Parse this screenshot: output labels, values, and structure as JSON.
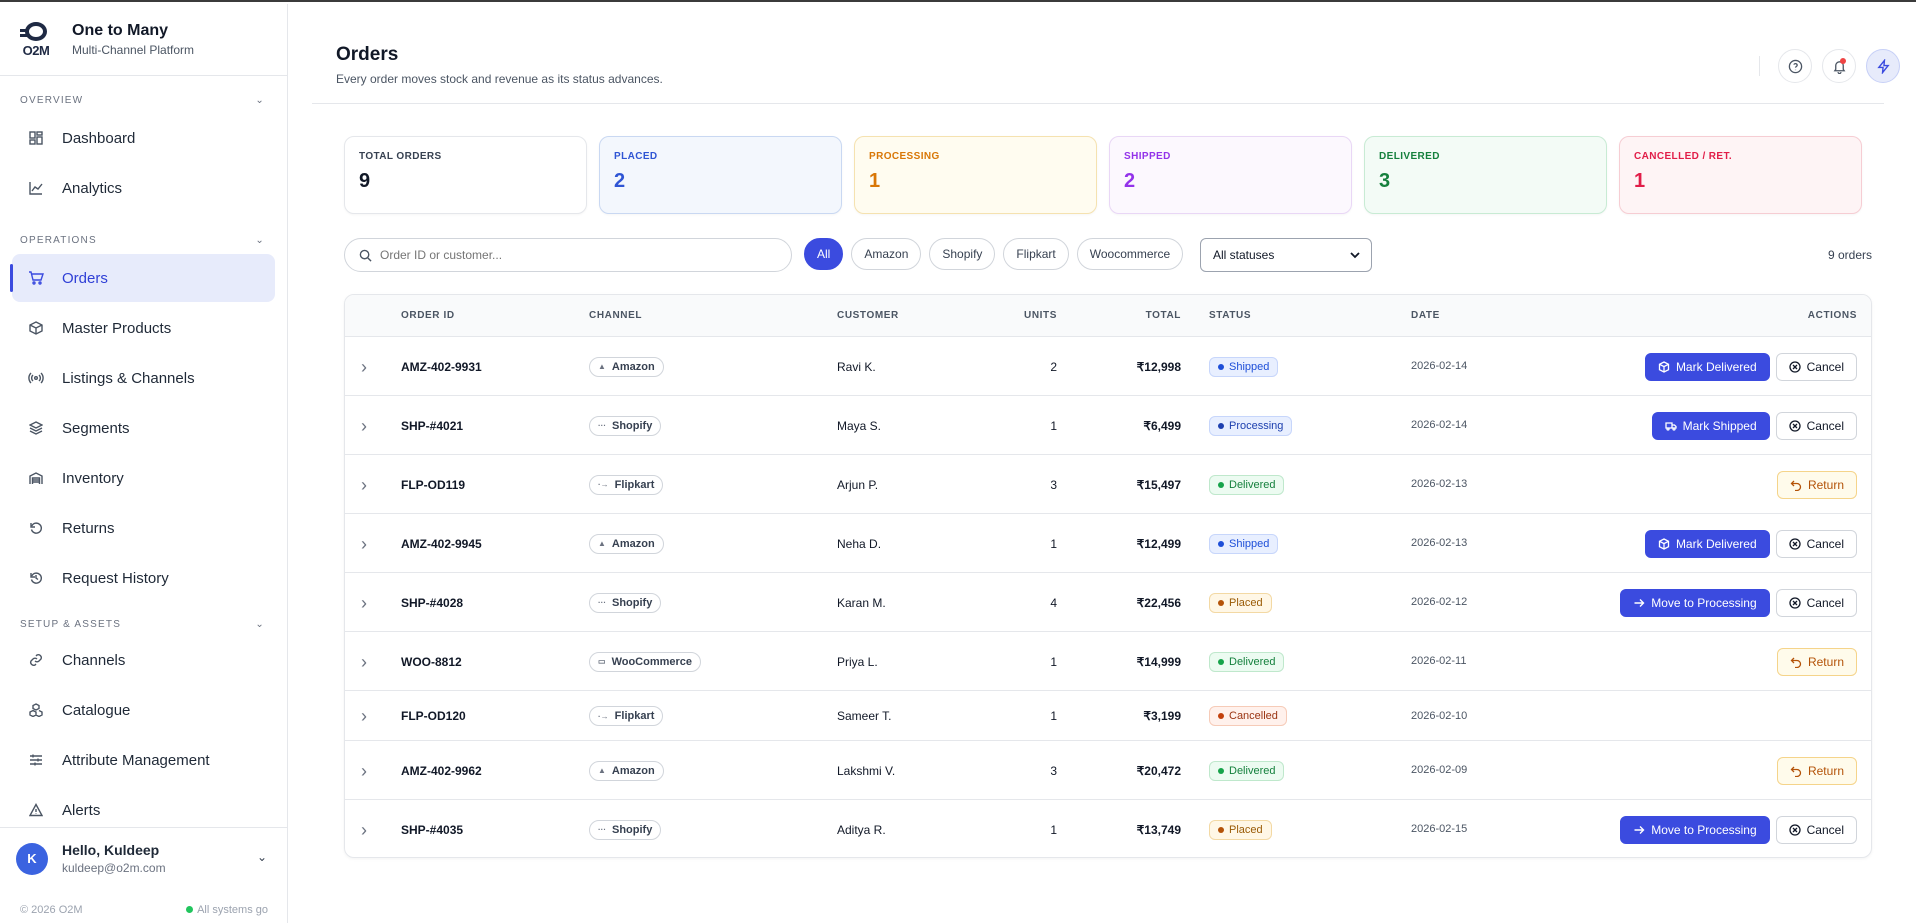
{
  "brand": {
    "logo": "O2M",
    "title": "One to Many",
    "subtitle": "Multi-Channel Platform"
  },
  "sections": {
    "overview": "OVERVIEW",
    "operations": "OPERATIONS",
    "setup": "SETUP & ASSETS"
  },
  "nav": {
    "dashboard": "Dashboard",
    "analytics": "Analytics",
    "orders": "Orders",
    "master_products": "Master Products",
    "listings": "Listings & Channels",
    "segments": "Segments",
    "inventory": "Inventory",
    "returns": "Returns",
    "request_history": "Request History",
    "channels": "Channels",
    "catalogue": "Catalogue",
    "attribute_management": "Attribute Management",
    "alerts": "Alerts"
  },
  "user": {
    "initial": "K",
    "greeting": "Hello, Kuldeep",
    "email": "kuldeep@o2m.com"
  },
  "footer": {
    "copyright": "© 2026 O2M",
    "status": "All systems go"
  },
  "page": {
    "title": "Orders",
    "subtitle": "Every order moves stock and revenue as its status advances."
  },
  "stats": [
    {
      "label": "TOTAL ORDERS",
      "value": "9",
      "color": "#111827",
      "bg": "#ffffff",
      "border": "#e5e7eb"
    },
    {
      "label": "PLACED",
      "value": "2",
      "color": "#2f55d4",
      "bg": "#f3f7fd",
      "border": "#c9d8f2"
    },
    {
      "label": "PROCESSING",
      "value": "1",
      "color": "#d97706",
      "bg": "#fffcf0",
      "border": "#f5e2b0"
    },
    {
      "label": "SHIPPED",
      "value": "2",
      "color": "#9333ea",
      "bg": "#fcf8fe",
      "border": "#e9d7f6"
    },
    {
      "label": "DELIVERED",
      "value": "3",
      "color": "#15803d",
      "bg": "#f3fbf6",
      "border": "#c8ebd4"
    },
    {
      "label": "CANCELLED / RET.",
      "value": "1",
      "color": "#e11d48",
      "bg": "#fef4f5",
      "border": "#f6cdd3"
    }
  ],
  "filters": {
    "search_placeholder": "Order ID or customer...",
    "chips": [
      "All",
      "Amazon",
      "Shopify",
      "Flipkart",
      "Woocommerce"
    ],
    "status_select": "All statuses",
    "count": "9 orders"
  },
  "table": {
    "headers": {
      "order_id": "ORDER ID",
      "channel": "CHANNEL",
      "customer": "CUSTOMER",
      "units": "UNITS",
      "total": "TOTAL",
      "status": "STATUS",
      "date": "DATE",
      "actions": "ACTIONS"
    },
    "rows": [
      {
        "id": "AMZ-402-9931",
        "channel": "Amazon",
        "customer": "Ravi K.",
        "units": "2",
        "total": "₹12,998",
        "status": "Shipped",
        "date": "2026-02-14",
        "actions": [
          "Mark Delivered",
          "Cancel"
        ]
      },
      {
        "id": "SHP-#4021",
        "channel": "Shopify",
        "customer": "Maya S.",
        "units": "1",
        "total": "₹6,499",
        "status": "Processing",
        "date": "2026-02-14",
        "actions": [
          "Mark Shipped",
          "Cancel"
        ]
      },
      {
        "id": "FLP-OD119",
        "channel": "Flipkart",
        "customer": "Arjun P.",
        "units": "3",
        "total": "₹15,497",
        "status": "Delivered",
        "date": "2026-02-13",
        "actions": [
          "Return"
        ]
      },
      {
        "id": "AMZ-402-9945",
        "channel": "Amazon",
        "customer": "Neha D.",
        "units": "1",
        "total": "₹12,499",
        "status": "Shipped",
        "date": "2026-02-13",
        "actions": [
          "Mark Delivered",
          "Cancel"
        ]
      },
      {
        "id": "SHP-#4028",
        "channel": "Shopify",
        "customer": "Karan M.",
        "units": "4",
        "total": "₹22,456",
        "status": "Placed",
        "date": "2026-02-12",
        "actions": [
          "Move to Processing",
          "Cancel"
        ]
      },
      {
        "id": "WOO-8812",
        "channel": "WooCommerce",
        "customer": "Priya L.",
        "units": "1",
        "total": "₹14,999",
        "status": "Delivered",
        "date": "2026-02-11",
        "actions": [
          "Return"
        ]
      },
      {
        "id": "FLP-OD120",
        "channel": "Flipkart",
        "customer": "Sameer T.",
        "units": "1",
        "total": "₹3,199",
        "status": "Cancelled",
        "date": "2026-02-10",
        "actions": []
      },
      {
        "id": "AMZ-402-9962",
        "channel": "Amazon",
        "customer": "Lakshmi V.",
        "units": "3",
        "total": "₹20,472",
        "status": "Delivered",
        "date": "2026-02-09",
        "actions": [
          "Return"
        ]
      },
      {
        "id": "SHP-#4035",
        "channel": "Shopify",
        "customer": "Aditya R.",
        "units": "1",
        "total": "₹13,749",
        "status": "Placed",
        "date": "2026-02-15",
        "actions": [
          "Move to Processing",
          "Cancel"
        ]
      }
    ]
  },
  "status_colors": {
    "Shipped": {
      "fg": "#1d4ed8",
      "bg": "#e8efff",
      "border": "#c7d6fb",
      "dot": "#1d4ed8"
    },
    "Processing": {
      "fg": "#1e40af",
      "bg": "#e8efff",
      "border": "#c7d6fb",
      "dot": "#1e40af"
    },
    "Delivered": {
      "fg": "#15803d",
      "bg": "#ecfbf1",
      "border": "#bfe8cc",
      "dot": "#16a34a"
    },
    "Placed": {
      "fg": "#9a5b06",
      "bg": "#fff7e6",
      "border": "#f3d9a4",
      "dot": "#b45309"
    },
    "Cancelled": {
      "fg": "#9a3412",
      "bg": "#fff1ec",
      "border": "#f6cbb8",
      "dot": "#c2410c"
    }
  },
  "accent": "#3b4bdf"
}
